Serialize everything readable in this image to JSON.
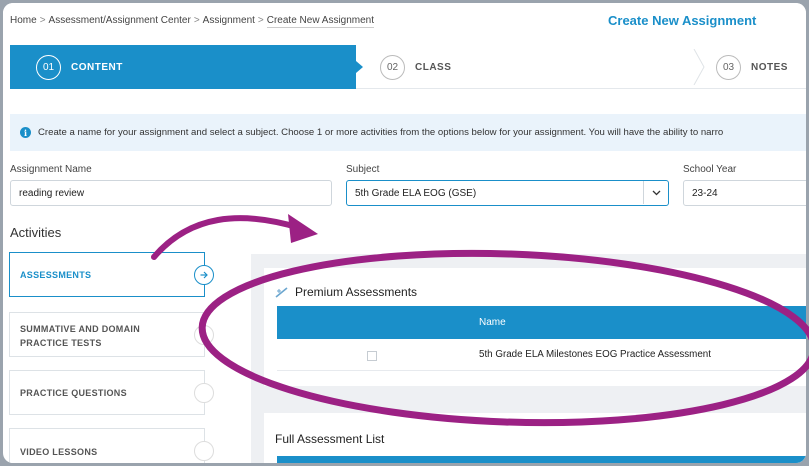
{
  "breadcrumb": {
    "items": [
      "Home",
      "Assessment/Assignment Center",
      "Assignment",
      "Create New Assignment"
    ],
    "separator": ">"
  },
  "page_title": "Create New Assignment",
  "stepper": {
    "steps": [
      {
        "number": "01",
        "label": "CONTENT",
        "active": true
      },
      {
        "number": "02",
        "label": "CLASS",
        "active": false
      },
      {
        "number": "03",
        "label": "NOTES",
        "active": false
      }
    ]
  },
  "info_banner": {
    "icon": "info-icon",
    "text": "Create a name for your assignment and select a subject. Choose 1 or more activities from the options below for your assignment. You will have the ability to narro"
  },
  "form": {
    "assignment_name": {
      "label": "Assignment Name",
      "value": "reading review"
    },
    "subject": {
      "label": "Subject",
      "value": "5th Grade ELA EOG (GSE)"
    },
    "school_year": {
      "label": "School Year",
      "value": "23-24"
    }
  },
  "activities": {
    "title": "Activities",
    "items": [
      {
        "line1": "ASSESSMENTS",
        "line2": "",
        "active": true
      },
      {
        "line1": "SUMMATIVE AND DOMAIN",
        "line2": "PRACTICE TESTS",
        "active": false
      },
      {
        "line1": "PRACTICE QUESTIONS",
        "line2": "",
        "active": false
      },
      {
        "line1": "VIDEO LESSONS",
        "line2": "",
        "active": false
      }
    ]
  },
  "premium": {
    "title": "Premium Assessments",
    "column_header": "Name",
    "rows": [
      {
        "name": "5th Grade ELA Milestones EOG Practice Assessment",
        "checked": false
      }
    ]
  },
  "full_list": {
    "title": "Full Assessment List"
  },
  "colors": {
    "accent": "#1a8fc9",
    "annotation": "#9c2184"
  }
}
